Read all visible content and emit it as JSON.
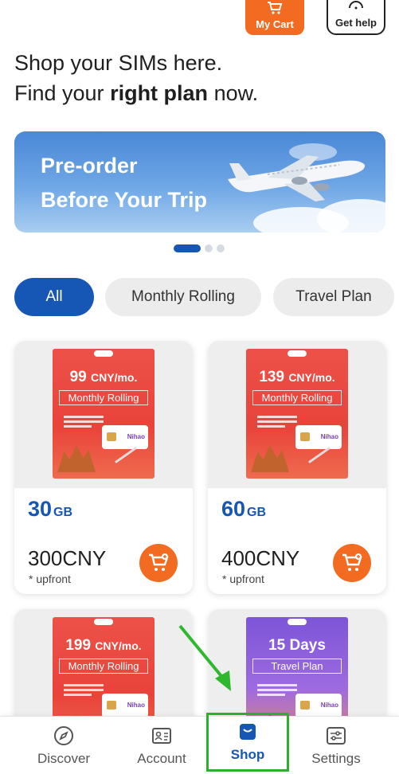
{
  "header": {
    "cart_label": "My Cart",
    "help_label": "Get help"
  },
  "headline": {
    "line1": "Shop your SIMs here.",
    "line2_before": "Find your ",
    "line2_bold": "right plan",
    "line2_after": " now."
  },
  "banner": {
    "line1": "Pre-order",
    "line2": "Before Your Trip",
    "page_count": 3,
    "active_index": 0
  },
  "filters": [
    {
      "label": "All",
      "selected": true
    },
    {
      "label": "Monthly Rolling",
      "selected": false
    },
    {
      "label": "Travel Plan",
      "selected": false
    }
  ],
  "products": [
    {
      "pack_price": "99",
      "pack_unit": "CNY/mo.",
      "pack_plan": "Monthly Rolling",
      "data_amount": "30",
      "data_unit": "GB",
      "price": "300CNY",
      "price_note": "* upfront",
      "color": "#e9433a"
    },
    {
      "pack_price": "139",
      "pack_unit": "CNY/mo.",
      "pack_plan": "Monthly Rolling",
      "data_amount": "60",
      "data_unit": "GB",
      "price": "400CNY",
      "price_note": "* upfront",
      "color": "#e9433a"
    },
    {
      "pack_price": "199",
      "pack_unit": "CNY/mo.",
      "pack_plan": "Monthly Rolling",
      "color": "#e9433a"
    },
    {
      "pack_price": "15 Days",
      "pack_unit": "",
      "pack_plan": "Travel Plan",
      "color": "#7d55d8"
    }
  ],
  "bottom_nav": [
    {
      "label": "Discover",
      "icon": "compass-icon",
      "active": false
    },
    {
      "label": "Account",
      "icon": "id-card-icon",
      "active": false
    },
    {
      "label": "Shop",
      "icon": "shopping-bag-icon",
      "active": true
    },
    {
      "label": "Settings",
      "icon": "sliders-icon",
      "active": false
    }
  ],
  "colors": {
    "brand_blue": "#1657b5",
    "brand_orange": "#f26b21",
    "highlight_green": "#29b12d"
  }
}
